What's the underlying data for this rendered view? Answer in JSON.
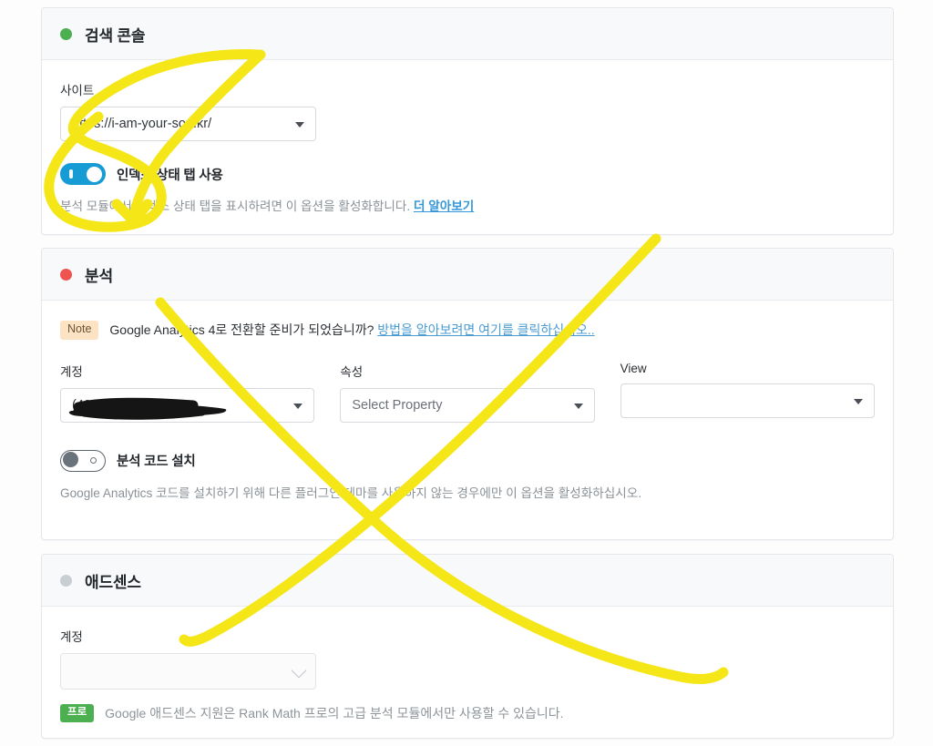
{
  "page": {
    "background": "#fdfdfd",
    "accent_blue": "#169bd5",
    "link_blue": "#3498db"
  },
  "sections": {
    "search_console": {
      "title": "검색 콘솔",
      "status_color": "#4caf50",
      "site_label": "사이트",
      "site_value": "https://i-am-your-son.kr/",
      "toggle_label": "인덱스 상태 탭 사용",
      "toggle_state": "on",
      "help_text": "분석 모듈에서 인덱스 상태 탭을 표시하려면 이 옵션을 활성화합니다. ",
      "help_link": "더 알아보기"
    },
    "analytics": {
      "title": "분석",
      "status_color": "#ef5350",
      "note_badge": "Note",
      "note_text": "Google Analytics 4로 전환할 준비가 되었습니까? ",
      "note_link": "방법을 알아보려면 여기를 클릭하십시오..",
      "account_label": "계정",
      "account_value": "(4261)",
      "account_redacted": true,
      "property_label": "속성",
      "property_value": "Select Property",
      "view_label": "View",
      "view_value": "",
      "toggle_label": "분석 코드 설치",
      "toggle_state": "off",
      "help_text": "Google Analytics 코드를 설치하기 위해 다른 플러그인/테마를 사용하지 않는 경우에만 이 옵션을 활성화하십시오."
    },
    "adsense": {
      "title": "애드센스",
      "status_color": "#c9ced3",
      "account_label": "계정",
      "account_value": "",
      "account_disabled": true,
      "pro_badge": "프로",
      "pro_text": "Google 애드센스 지원은 Rank Math 프로의 고급 분석 모듈에서만 사용할 수 있습니다."
    }
  },
  "annotations": {
    "marker_color": "#f5e618",
    "redaction_color": "#151515",
    "shapes": [
      {
        "name": "circle-around-index-toggle",
        "kind": "freehand-ellipse"
      },
      {
        "name": "arrow-into-toggle",
        "kind": "freehand-arrow"
      },
      {
        "name": "cross-over-analytics-stroke-1",
        "kind": "freehand-line"
      },
      {
        "name": "cross-over-analytics-stroke-2",
        "kind": "freehand-line"
      }
    ]
  }
}
